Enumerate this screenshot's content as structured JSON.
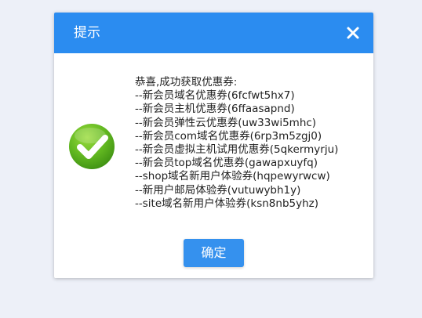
{
  "dialog": {
    "title": "提示",
    "close_icon": "close-icon",
    "status_icon": "check-circle-icon",
    "colors": {
      "header": "#2b8cf0",
      "button": "#3591ee",
      "check_green": "#58b21d",
      "background": "#edf0f8"
    },
    "message": {
      "heading": "恭喜,成功获取优惠券:",
      "lines": [
        "--新会员域名优惠券(6fcfwt5hx7)",
        "--新会员主机优惠券(6ffaasapnd)",
        "--新会员弹性云优惠券(uw33wi5mhc)",
        "--新会员com域名优惠券(6rp3m5zgj0)",
        "--新会员虚拟主机试用优惠券(5qkermyrju)",
        "--新会员top域名优惠券(gawapxuyfq)",
        "--shop域名新用户体验券(hqpewyrwcw)",
        "--新用户邮局体验券(vutuwybh1y)",
        "--site域名新用户体验券(ksn8nb5yhz)"
      ]
    },
    "ok_label": "确定"
  }
}
